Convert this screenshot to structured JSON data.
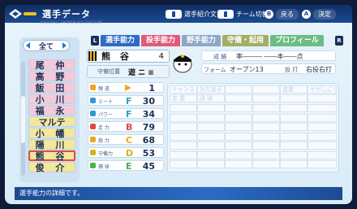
{
  "window": {
    "title": "選手データ",
    "subtitle": "BASEBALL PAWAPURO STADIUM"
  },
  "header_hints": [
    {
      "key": "button",
      "label": "選手紹介文"
    },
    {
      "key": "button",
      "label": "チーム切替"
    },
    {
      "key": "B",
      "label": "戻る"
    },
    {
      "key": "A",
      "label": "決定"
    }
  ],
  "roster": {
    "filter_label": "全て",
    "players": [
      {
        "name": "尾 仲",
        "color": "pink"
      },
      {
        "name": "高 野",
        "color": "pink"
      },
      {
        "name": "飯 田",
        "color": "pink"
      },
      {
        "name": "小 川",
        "color": "pink"
      },
      {
        "name": "福 永",
        "color": "pink"
      },
      {
        "name": "マルテ",
        "color": "yellow"
      },
      {
        "name": "小 幡",
        "color": "yellow"
      },
      {
        "name": "陽 川",
        "color": "yellow"
      },
      {
        "name": "熊 谷",
        "color": "selected"
      },
      {
        "name": "俊 介",
        "color": "yellow"
      }
    ]
  },
  "tabs": {
    "left_key": "L",
    "right_key": "R",
    "items": [
      {
        "label": "選手能力",
        "active": true
      },
      {
        "label": "投手能力",
        "active": false
      },
      {
        "label": "野手能力",
        "active": false
      },
      {
        "label": "守備・起用",
        "active": false
      },
      {
        "label": "プロフィール",
        "active": false
      }
    ]
  },
  "player": {
    "name": "熊 谷",
    "number": "4",
    "position_label": "守備位置",
    "positions": "遊 ニ ≡"
  },
  "abilities": [
    {
      "label": "弾 道",
      "grade": "",
      "value": "1",
      "color": "#f1a51e",
      "type": "trajectory"
    },
    {
      "label": "ミート",
      "grade": "F",
      "value": "30",
      "color": "#2f9bd6",
      "type": "grade"
    },
    {
      "label": "パワー",
      "grade": "F",
      "value": "34",
      "color": "#2f9bd6",
      "type": "grade"
    },
    {
      "label": "走 力",
      "grade": "B",
      "value": "79",
      "color": "#e04a45",
      "type": "grade"
    },
    {
      "label": "肩 力",
      "grade": "C",
      "value": "68",
      "color": "#f1a51e",
      "type": "grade"
    },
    {
      "label": "守備力",
      "grade": "D",
      "value": "53",
      "color": "#d8b21a",
      "type": "grade"
    },
    {
      "label": "捕 球",
      "grade": "E",
      "value": "45",
      "color": "#4caf50",
      "type": "grade"
    }
  ],
  "info": {
    "row1": {
      "label": "成 績",
      "value": "率―――  ――本――点"
    },
    "row2": {
      "label": "フォーム",
      "value": "オープン13",
      "label2": "投 打",
      "value2": "右投右打"
    }
  },
  "special_grid": {
    "cells": [
      "チャンス",
      "対左投手",
      "",
      "",
      "盗塁",
      "ケガしにくさ",
      "走 塁",
      "送 球",
      "",
      "",
      "",
      ""
    ]
  },
  "message": "選手能力の詳細です。"
}
